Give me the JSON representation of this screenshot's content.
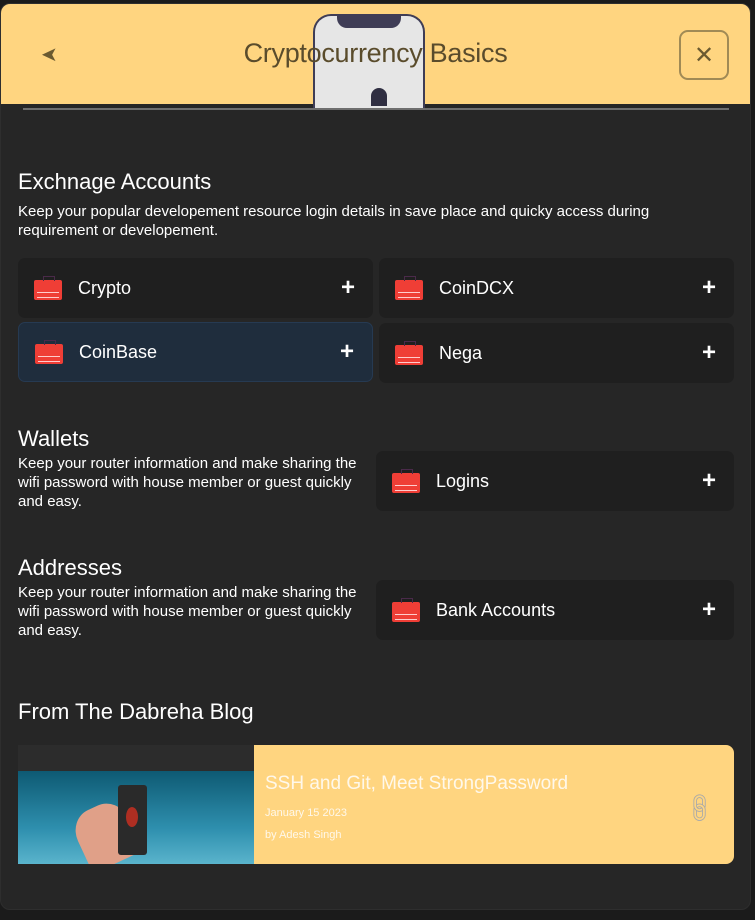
{
  "header": {
    "title": "Cryptocurrency Basics",
    "back_icon": "chevron-left-icon",
    "close_icon": "close-icon"
  },
  "exchange": {
    "title": "Exchnage Accounts",
    "description": "Keep your popular developement resource login details in save place and quicky access during requirement or developement.",
    "items": [
      {
        "label": "Crypto"
      },
      {
        "label": "CoinDCX"
      },
      {
        "label": "CoinBase"
      },
      {
        "label": "Nega"
      }
    ]
  },
  "wallets": {
    "title": "Wallets",
    "description": "Keep your router information and make sharing the wifi password with house member or guest quickly and easy.",
    "item": {
      "label": "Logins"
    }
  },
  "addresses": {
    "title": "Addresses",
    "description": "Keep your router information and make sharing the wifi password with house member or guest quickly and easy.",
    "item": {
      "label": "Bank Accounts"
    }
  },
  "blog": {
    "section_title": "From The Dabreha Blog",
    "post": {
      "title": "SSH and Git, Meet StrongPassword",
      "date": "January 15 2023",
      "author": "by Adesh Singh"
    }
  },
  "plus": "+",
  "close_glyph": "✕",
  "back_glyph": "➤"
}
